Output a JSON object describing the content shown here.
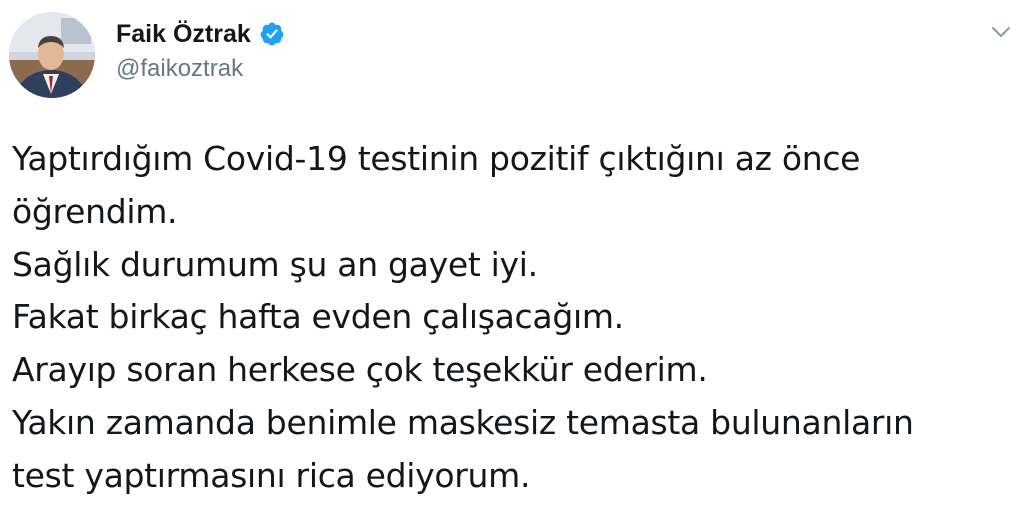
{
  "author": {
    "name": "Faik Öztrak",
    "handle": "@faikoztrak",
    "verified": true
  },
  "icons": {
    "verified": "verified-badge-icon",
    "caret": "chevron-down-icon"
  },
  "colors": {
    "verified_blue": "#1da1f2",
    "handle_gray": "#657786",
    "text": "#14171a"
  },
  "tweet": {
    "lines": [
      "Yaptırdığım Covid-19 testinin pozitif çıktığını az önce",
      "öğrendim.",
      "Sağlık durumum şu an gayet iyi.",
      "Fakat birkaç hafta evden çalışacağım.",
      "Arayıp soran herkese çok teşekkür ederim.",
      "Yakın zamanda benimle maskesiz temasta bulunanların",
      "test yaptırmasını rica ediyorum."
    ]
  }
}
